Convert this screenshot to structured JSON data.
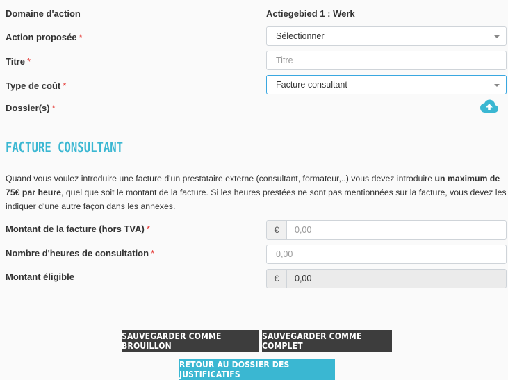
{
  "fields": {
    "domaine": {
      "label": "Domaine d'action",
      "value": "Actiegebied 1 : Werk"
    },
    "action": {
      "label": "Action proposée",
      "required": "*",
      "value": "Sélectionner"
    },
    "titre": {
      "label": "Titre",
      "required": "*",
      "placeholder": "Titre"
    },
    "type_cout": {
      "label": "Type de coût",
      "required": "*",
      "value": "Facture consultant"
    },
    "dossiers": {
      "label": "Dossier(s)",
      "required": "*"
    }
  },
  "section": {
    "title": "FACTURE CONSULTANT",
    "para_1": "Quand vous voulez introduire une facture d'un prestataire externe (consultant, formateur,..) vous devez introduire ",
    "para_bold": "un maximum de 75€ par heure",
    "para_2": ", quel que soit le montant de la facture. Si les heures prestées ne sont pas mentionnées sur la facture, vous devez les indiquer d'une autre façon dans les annexes."
  },
  "invoice": {
    "montant": {
      "label": "Montant de la facture (hors TVA)",
      "required": "*",
      "currency": "€",
      "placeholder": "0,00"
    },
    "heures": {
      "label": "Nombre d'heures de consultation",
      "required": "*",
      "placeholder": "0,00"
    },
    "eligible": {
      "label": "Montant éligible",
      "currency": "€",
      "value": "0,00"
    }
  },
  "buttons": {
    "draft": "SAUVEGARDER COMME BROUILLON",
    "complete": "SAUVEGARDER COMME COMPLET",
    "back": "RETOUR AU DOSSIER DES JUSTIFICATIFS"
  },
  "colors": {
    "accent": "#3ab7d2",
    "required": "#e53935",
    "button_dark": "#3d3d3d"
  },
  "icons": {
    "upload": "cloud-upload-icon"
  }
}
